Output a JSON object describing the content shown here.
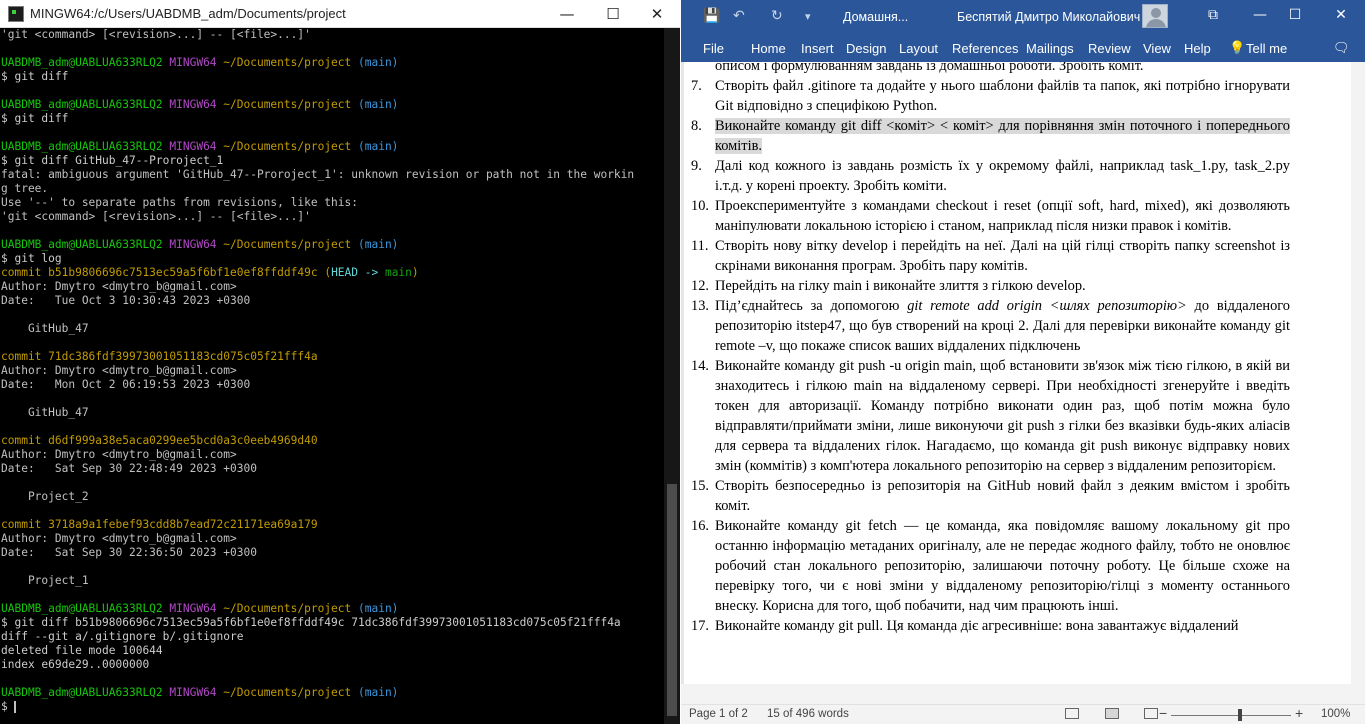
{
  "terminal": {
    "title": "MINGW64:/c/Users/UABDMB_adm/Documents/project",
    "controls": {
      "minimize": "—",
      "maximize": "☐",
      "close": "✕"
    },
    "lines": [
      [
        {
          "t": "'git <command> [<revision>...] -- [<file>...]'",
          "c": ""
        }
      ],
      [
        {
          "t": "",
          "c": ""
        }
      ],
      [
        {
          "t": "UABDMB_adm@UABLUA633RLQ2 ",
          "c": "g"
        },
        {
          "t": "MINGW64 ",
          "c": "m"
        },
        {
          "t": "~/Documents/project ",
          "c": "y"
        },
        {
          "t": "(main)",
          "c": "c"
        }
      ],
      [
        {
          "t": "$ git diff",
          "c": "w"
        }
      ],
      [
        {
          "t": "",
          "c": ""
        }
      ],
      [
        {
          "t": "UABDMB_adm@UABLUA633RLQ2 ",
          "c": "g"
        },
        {
          "t": "MINGW64 ",
          "c": "m"
        },
        {
          "t": "~/Documents/project ",
          "c": "y"
        },
        {
          "t": "(main)",
          "c": "c"
        }
      ],
      [
        {
          "t": "$ git diff",
          "c": "w"
        }
      ],
      [
        {
          "t": "",
          "c": ""
        }
      ],
      [
        {
          "t": "UABDMB_adm@UABLUA633RLQ2 ",
          "c": "g"
        },
        {
          "t": "MINGW64 ",
          "c": "m"
        },
        {
          "t": "~/Documents/project ",
          "c": "y"
        },
        {
          "t": "(main)",
          "c": "c"
        }
      ],
      [
        {
          "t": "$ git diff GitHub_47--Proroject_1",
          "c": "w"
        }
      ],
      [
        {
          "t": "fatal: ambiguous argument 'GitHub_47--Proroject_1': unknown revision or path not in the workin",
          "c": ""
        }
      ],
      [
        {
          "t": "g tree.",
          "c": ""
        }
      ],
      [
        {
          "t": "Use '--' to separate paths from revisions, like this:",
          "c": ""
        }
      ],
      [
        {
          "t": "'git <command> [<revision>...] -- [<file>...]'",
          "c": ""
        }
      ],
      [
        {
          "t": "",
          "c": ""
        }
      ],
      [
        {
          "t": "UABDMB_adm@UABLUA633RLQ2 ",
          "c": "g"
        },
        {
          "t": "MINGW64 ",
          "c": "m"
        },
        {
          "t": "~/Documents/project ",
          "c": "y"
        },
        {
          "t": "(main)",
          "c": "c"
        }
      ],
      [
        {
          "t": "$ git log",
          "c": "w"
        }
      ],
      [
        {
          "t": "commit b51b9806696c7513ec59a5f6bf1e0ef8ffddf49c ",
          "c": "y"
        },
        {
          "t": "(",
          "c": "y"
        },
        {
          "t": "HEAD -> ",
          "c": "cy"
        },
        {
          "t": "main",
          "c": "gr"
        },
        {
          "t": ")",
          "c": "y"
        }
      ],
      [
        {
          "t": "Author: Dmytro <dmytro_b@gmail.com>",
          "c": ""
        }
      ],
      [
        {
          "t": "Date:   Tue Oct 3 10:30:43 2023 +0300",
          "c": ""
        }
      ],
      [
        {
          "t": "",
          "c": ""
        }
      ],
      [
        {
          "t": "    GitHub_47",
          "c": ""
        }
      ],
      [
        {
          "t": "",
          "c": ""
        }
      ],
      [
        {
          "t": "commit 71dc386fdf39973001051183cd075c05f21fff4a",
          "c": "y"
        }
      ],
      [
        {
          "t": "Author: Dmytro <dmytro_b@gmail.com>",
          "c": ""
        }
      ],
      [
        {
          "t": "Date:   Mon Oct 2 06:19:53 2023 +0300",
          "c": ""
        }
      ],
      [
        {
          "t": "",
          "c": ""
        }
      ],
      [
        {
          "t": "    GitHub_47",
          "c": ""
        }
      ],
      [
        {
          "t": "",
          "c": ""
        }
      ],
      [
        {
          "t": "commit d6df999a38e5aca0299ee5bcd0a3c0eeb4969d40",
          "c": "y"
        }
      ],
      [
        {
          "t": "Author: Dmytro <dmytro_b@gmail.com>",
          "c": ""
        }
      ],
      [
        {
          "t": "Date:   Sat Sep 30 22:48:49 2023 +0300",
          "c": ""
        }
      ],
      [
        {
          "t": "",
          "c": ""
        }
      ],
      [
        {
          "t": "    Project_2",
          "c": ""
        }
      ],
      [
        {
          "t": "",
          "c": ""
        }
      ],
      [
        {
          "t": "commit 3718a9a1febef93cdd8b7ead72c21171ea69a179",
          "c": "y"
        }
      ],
      [
        {
          "t": "Author: Dmytro <dmytro_b@gmail.com>",
          "c": ""
        }
      ],
      [
        {
          "t": "Date:   Sat Sep 30 22:36:50 2023 +0300",
          "c": ""
        }
      ],
      [
        {
          "t": "",
          "c": ""
        }
      ],
      [
        {
          "t": "    Project_1",
          "c": ""
        }
      ],
      [
        {
          "t": "",
          "c": ""
        }
      ],
      [
        {
          "t": "UABDMB_adm@UABLUA633RLQ2 ",
          "c": "g"
        },
        {
          "t": "MINGW64 ",
          "c": "m"
        },
        {
          "t": "~/Documents/project ",
          "c": "y"
        },
        {
          "t": "(main)",
          "c": "c"
        }
      ],
      [
        {
          "t": "$ git diff b51b9806696c7513ec59a5f6bf1e0ef8ffddf49c 71dc386fdf39973001051183cd075c05f21fff4a",
          "c": "w"
        }
      ],
      [
        {
          "t": "diff --git a/.gitignore b/.gitignore",
          "c": "w"
        }
      ],
      [
        {
          "t": "deleted file mode 100644",
          "c": "w"
        }
      ],
      [
        {
          "t": "index e69de29..0000000",
          "c": "w"
        }
      ],
      [
        {
          "t": "",
          "c": ""
        }
      ],
      [
        {
          "t": "UABDMB_adm@UABLUA633RLQ2 ",
          "c": "g"
        },
        {
          "t": "MINGW64 ",
          "c": "m"
        },
        {
          "t": "~/Documents/project ",
          "c": "y"
        },
        {
          "t": "(main)",
          "c": "c"
        }
      ],
      [
        {
          "t": "$ ",
          "c": "w"
        }
      ]
    ]
  },
  "word": {
    "doc_title": "Домашня...",
    "user_name": "Беспятий Дмитро Миколайович",
    "qat": {
      "save": "💾",
      "undo": "↶",
      "redo": "↻",
      "customize": "▾"
    },
    "window_controls": {
      "ribbon_options": "⧉",
      "minimize": "—",
      "maximize": "☐",
      "close": "✕"
    },
    "tabs": [
      "File",
      "Home",
      "Insert",
      "Design",
      "Layout",
      "References",
      "Mailings",
      "Review",
      "View",
      "Help"
    ],
    "tell_me": "Tell me",
    "share_icon": "🗨",
    "top_partial": "описом і формулюванням завдань із домашньої роботи. Зробіть коміт.",
    "items": [
      {
        "num": "7.",
        "text": "Створіть файл .gitinore та додайте у нього шаблони файлів та папок, які потрібно ігнорувати Git відповідно з специфікою Python."
      },
      {
        "num": "8.",
        "text": "Виконайте команду git diff  <коміт> < коміт> для порівняння змін поточного і попереднього комітів. "
      },
      {
        "num": "9.",
        "text": "Далі код кожного із завдань розмість їх у окремому файлі, наприклад  task_1.py, task_2.py і.т.д. у корені проекту. Зробіть коміти."
      },
      {
        "num": "10.",
        "text": "Проекспериментуйте з командами checkout і reset (опції soft, hard, mixed), які дозволяють маніпулювати локальною історією і станом, наприклад після низки правок і комітів."
      },
      {
        "num": "11.",
        "text": "Створіть нову вітку develop і перейдіть на неї. Далі на цій гілці створіть папку screenshot із скрінами виконання програм. Зробіть пару комітів."
      },
      {
        "num": "12.",
        "text": "Перейдіть на гілку main і виконайте злиття з гілкою develop."
      },
      {
        "num": "13.",
        "pre": "Під’єднайтесь за допомогою ",
        "italic": "git remote add origin <шлях репозиторію>",
        "post": " до віддаленого репозиторію itstep47, що був створений на кроці 2. Далі для перевірки виконайте команду git remote –v, що покаже список ваших віддалених підключень"
      },
      {
        "num": "14.",
        "text": "Виконайте команду git push -u origin main,  щоб встановити зв'язок між тією гілкою, в якій ви знаходитесь і гілкою main на віддаленому сервері. При необхідності згенеруйте і введіть токен для авторизації. Команду потрібно виконати один раз, щоб потім можна було відправляти/приймати зміни, лише виконуючи git push з гілки без вказівки будь-яких аліасів для сервера та віддалених гілок. Нагадаємо, що команда git push виконує відправку нових змін (коммітів) з комп'ютера локального репозиторію на сервер з віддаленим репозиторієм."
      },
      {
        "num": "15.",
        "text": "Створіть безпосередньо із репозиторія на GitHub новий файл з деяким вмістом і зробіть коміт."
      },
      {
        "num": "16.",
        "text": "Виконайте команду git fetch — це команда, яка повідомляє вашому локальному git про останню інформацію метаданих оригіналу, але не передає жодного файлу, тобто не оновлює робочий стан локального репозиторію, залишаючи поточну роботу. Це більше схоже на перевірку того, чи є нові зміни у віддаленому репозиторію/гілці з моменту останнього внеску. Корисна для того, щоб побачити, над чим працюють інші."
      },
      {
        "num": "17.",
        "text": "Виконайте команду git pull. Ця команда діє агресивніше: вона завантажує віддалений"
      }
    ],
    "status": {
      "page": "Page 1 of 2",
      "words": "15 of 496 words",
      "zoom": "100%",
      "zoom_minus": "−",
      "zoom_plus": "+"
    }
  }
}
